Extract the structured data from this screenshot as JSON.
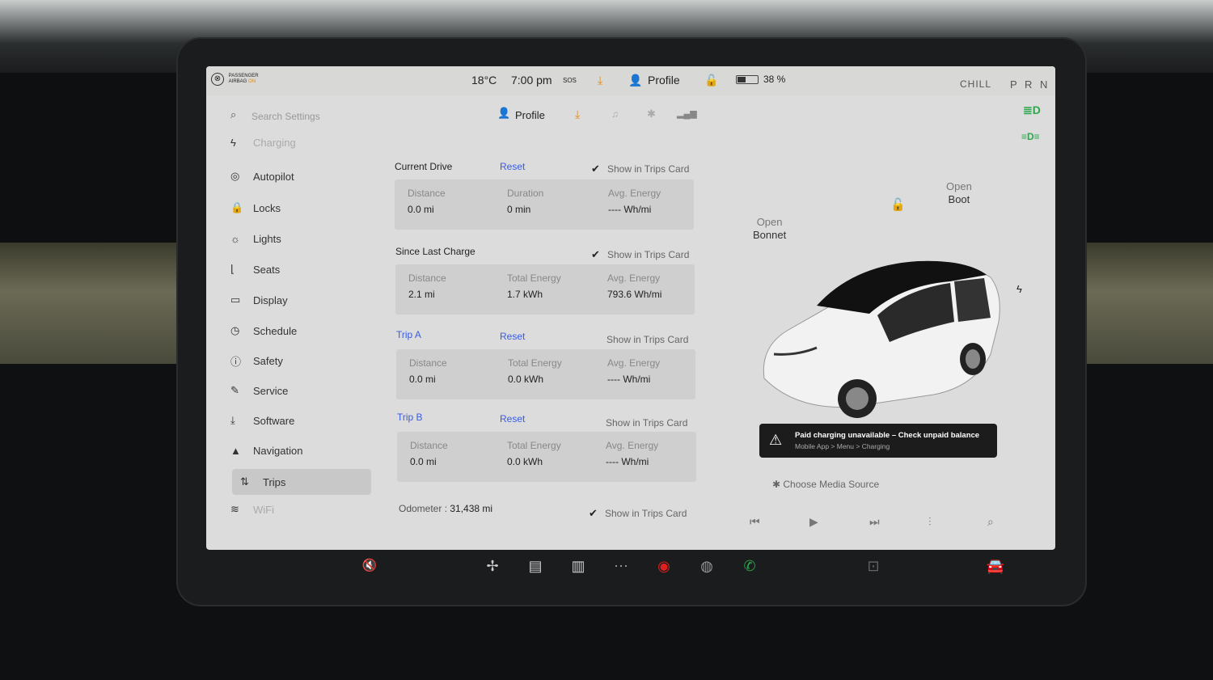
{
  "status": {
    "airbag_line1": "PASSENGER",
    "airbag_line2": "AIRBAG",
    "airbag_state": "ON",
    "temperature": "18°C",
    "time": "7:00 pm",
    "sos": "SOS",
    "profile": "Profile",
    "battery_percent": "38 %",
    "battery_level": 0.38,
    "drive_mode": "CHILL",
    "gears": "P R N D"
  },
  "search": {
    "placeholder": "Search Settings"
  },
  "top_profile": "Profile",
  "sidebar": {
    "items": [
      {
        "label": "Charging",
        "icon": "bolt-icon"
      },
      {
        "label": "Autopilot",
        "icon": "steering-wheel-icon"
      },
      {
        "label": "Locks",
        "icon": "lock-icon"
      },
      {
        "label": "Lights",
        "icon": "sun-icon"
      },
      {
        "label": "Seats",
        "icon": "seat-icon"
      },
      {
        "label": "Display",
        "icon": "display-icon"
      },
      {
        "label": "Schedule",
        "icon": "clock-icon"
      },
      {
        "label": "Safety",
        "icon": "alert-circle-icon"
      },
      {
        "label": "Service",
        "icon": "wrench-icon"
      },
      {
        "label": "Software",
        "icon": "download-icon"
      },
      {
        "label": "Navigation",
        "icon": "navigation-icon"
      },
      {
        "label": "Trips",
        "icon": "trips-icon"
      },
      {
        "label": "WiFi",
        "icon": "wifi-icon"
      }
    ]
  },
  "trips": {
    "current_drive": {
      "title": "Current Drive",
      "reset": "Reset",
      "show_label": "Show in Trips Card",
      "show": true,
      "c1_label": "Distance",
      "c1_value": "0.0 mi",
      "c2_label": "Duration",
      "c2_value": "0 min",
      "c3_label": "Avg. Energy",
      "c3_value": "---- Wh/mi"
    },
    "since_last_charge": {
      "title": "Since Last Charge",
      "show_label": "Show in Trips Card",
      "show": true,
      "c1_label": "Distance",
      "c1_value": "2.1 mi",
      "c2_label": "Total Energy",
      "c2_value": "1.7 kWh",
      "c3_label": "Avg. Energy",
      "c3_value": "793.6 Wh/mi"
    },
    "trip_a": {
      "title": "Trip A",
      "reset": "Reset",
      "show_label": "Show in Trips Card",
      "show": false,
      "c1_label": "Distance",
      "c1_value": "0.0 mi",
      "c2_label": "Total Energy",
      "c2_value": "0.0 kWh",
      "c3_label": "Avg. Energy",
      "c3_value": "---- Wh/mi"
    },
    "trip_b": {
      "title": "Trip B",
      "reset": "Reset",
      "show_label": "Show in Trips Card",
      "show": false,
      "c1_label": "Distance",
      "c1_value": "0.0 mi",
      "c2_label": "Total Energy",
      "c2_value": "0.0 kWh",
      "c3_label": "Avg. Energy",
      "c3_value": "---- Wh/mi"
    },
    "odometer_label": "Odometer :",
    "odometer_value": "31,438 mi",
    "odometer_show_label": "Show in Trips Card",
    "odometer_show": true
  },
  "car": {
    "boot_action": "Open",
    "boot_label": "Boot",
    "bonnet_action": "Open",
    "bonnet_label": "Bonnet"
  },
  "alert": {
    "title": "Paid charging unavailable – Check unpaid balance",
    "subtitle": "Mobile App > Menu > Charging"
  },
  "media": {
    "source_label": "Choose Media Source"
  }
}
